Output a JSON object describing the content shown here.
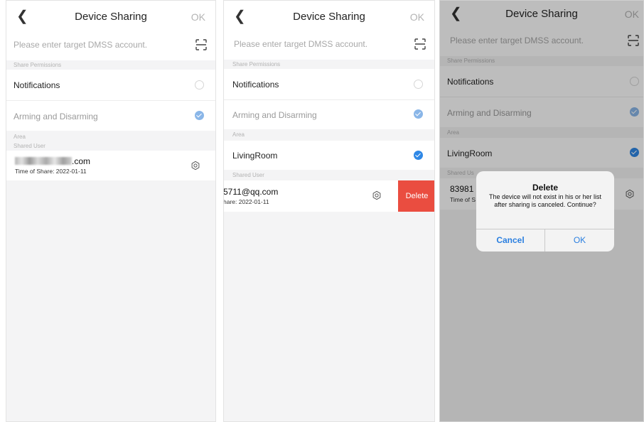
{
  "nav": {
    "back_icon": "chevron-left-icon",
    "title": "Device Sharing",
    "ok": "OK"
  },
  "account_input": {
    "placeholder": "Please enter target DMSS account.",
    "scan_icon": "scan-icon"
  },
  "sections": {
    "share_permissions": "Share Permissions",
    "area": "Area",
    "shared_user": "Shared User"
  },
  "permissions": [
    {
      "label": "Notifications",
      "selected": false
    },
    {
      "label": "Arming and Disarming",
      "selected": true
    }
  ],
  "areas": [
    {
      "label": "LivingRoom",
      "selected": true
    }
  ],
  "screen1": {
    "shared_user_email_suffix": ".com",
    "shared_time": "Time of Share:  2022-01-11"
  },
  "screen2": {
    "shared_user_email": "5711@qq.com",
    "shared_time": "hare:  2022-01-11",
    "delete_label": "Delete"
  },
  "screen3": {
    "shared_user_header": "Shared Us",
    "shared_user_email": "83981",
    "shared_time": "Time of S"
  },
  "dialog": {
    "title": "Delete",
    "message": "The device will not exist in his or her list after sharing is canceled. Continue?",
    "cancel": "Cancel",
    "ok": "OK"
  },
  "colors": {
    "accent": "#2f88e6",
    "delete": "#ea4d40",
    "section_bg": "#f4f4f5",
    "ok_disabled": "#b4b4b4"
  }
}
